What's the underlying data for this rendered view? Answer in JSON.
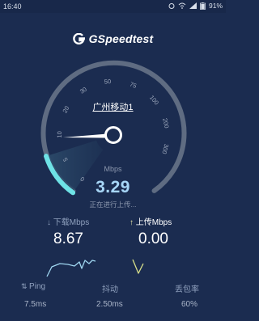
{
  "status_bar": {
    "time": "16:40",
    "battery": "91%"
  },
  "app": {
    "name": "GSpeedtest"
  },
  "gauge": {
    "ticks": [
      "0",
      "5",
      "10",
      "20",
      "30",
      "50",
      "75",
      "100",
      "200",
      "300"
    ],
    "progress_fraction": 0.15,
    "accent_color": "#6ee2e6",
    "track_color": "#5f6c82"
  },
  "server": {
    "name": "广州移动1"
  },
  "result": {
    "unit": "Mbps",
    "value": "3.29",
    "status": "正在进行上传..."
  },
  "download": {
    "label": "下载Mbps",
    "value": "8.67"
  },
  "upload": {
    "label": "上传Mbps",
    "value": "0.00"
  },
  "ping": {
    "label": "Ping",
    "value": "7.5ms"
  },
  "jitter": {
    "label": "抖动",
    "value": "2.50ms"
  },
  "packet_loss": {
    "label": "丢包率",
    "value": "60%"
  },
  "colors": {
    "background": "#1b2c50",
    "speed_text": "#a7d6f7",
    "sparkline": "#9fd6f0",
    "upload_sparkline": "#d8e08a"
  }
}
